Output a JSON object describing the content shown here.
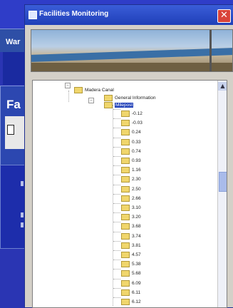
{
  "background": {
    "war_label": "War",
    "fa_label": "Fa"
  },
  "dialog": {
    "title": "Facilities Monitoring",
    "close_symbol": "✕"
  },
  "tree": {
    "root": "Madera Canal",
    "children": [
      {
        "label": "General Information",
        "selected": false
      },
      {
        "label": "Milepost",
        "selected": true
      }
    ],
    "mileposts": [
      "-0.12",
      "-0.03",
      "0.24",
      "0.33",
      "0.74",
      "0.93",
      "1.16",
      "2.30",
      "2.50",
      "2.66",
      "3.10",
      "3.20",
      "3.68",
      "3.74",
      "3.81",
      "4.57",
      "5.38",
      "5.68",
      "6.09",
      "6.11",
      "6.12"
    ]
  },
  "icons": {
    "close": "close-icon",
    "folder": "folder-icon",
    "app": "app-icon"
  },
  "colors": {
    "titlebar": "#1f3fb8",
    "desktop": "#2a35b3",
    "close": "#d9443a",
    "selection": "#1f3fb8"
  }
}
